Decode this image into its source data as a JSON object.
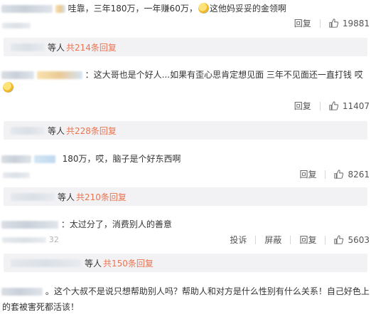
{
  "comments": [
    {
      "text": "哇靠，三年180万，一年赚60万，",
      "text_after_emoji": "这他妈妥妥的金领啊",
      "emoji": "laugh-cry-emoji",
      "reply_label": "回复",
      "likes": "19881",
      "reply_summary": {
        "prefix": "等人",
        "count_text": "共214条回复"
      }
    },
    {
      "text": "：这大哥也是个好人...如果有歪心思肯定想见面 三年不见面还一直打钱 哎",
      "emoji": "laugh-cry-emoji",
      "reply_label": "回复",
      "likes": "11407",
      "reply_summary": {
        "prefix": "等人",
        "count_text": "共228条回复"
      }
    },
    {
      "text": "180万，哎，脑子是个好东西啊",
      "reply_label": "回复",
      "likes": "8261",
      "reply_summary": {
        "prefix": "等人",
        "count_text": "共210条回复"
      }
    },
    {
      "text": "：太过分了，消费别人的善意",
      "time_fragment": "32",
      "report_label": "投诉",
      "block_label": "屏蔽",
      "reply_label": "回复",
      "likes": "5603",
      "reply_summary": {
        "prefix": "等人",
        "count_text": "共150条回复"
      }
    },
    {
      "text_line1": "。这个大叔不是说只想帮助别人吗？帮助人和对方是什么性别有什么关系！自己好色上",
      "text_line2": "的套被害死都活该！"
    }
  ],
  "icons": {
    "like": "thumbs-up-icon"
  },
  "colors": {
    "link": "#eb7350",
    "reply_bar_bg": "#f2f2f5",
    "text": "#333333",
    "muted": "#555555"
  }
}
